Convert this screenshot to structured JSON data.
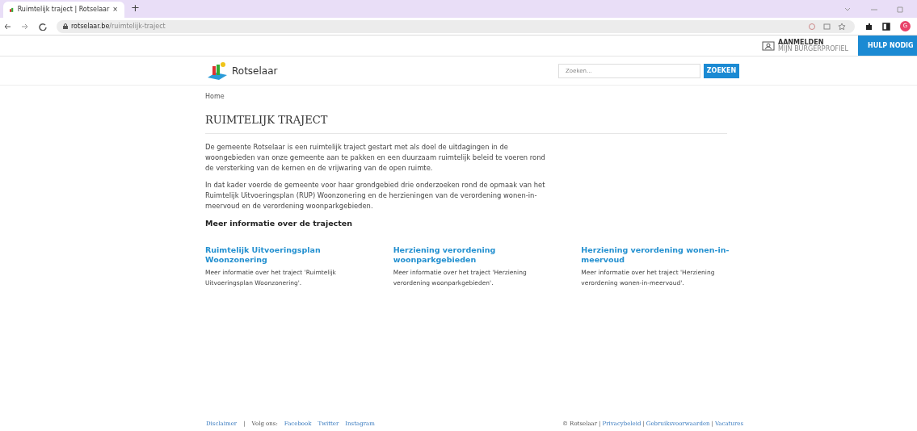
{
  "browser": {
    "tab_title": "Ruimtelijk traject | Rotselaar",
    "close": "×",
    "new_tab": "+",
    "url_host": "rotselaar.be",
    "url_path": "/ruimtelijk-traject",
    "profile_initial": "G"
  },
  "topbar": {
    "login_title": "AANMELDEN",
    "login_subtitle": "MIJN BURGERPROFIEL",
    "help": "HULP NODIG"
  },
  "header": {
    "logo_text": "Rotselaar",
    "search_placeholder": "Zoeken...",
    "search_button": "ZOEKEN"
  },
  "breadcrumb": "Home",
  "title": "RUIMTELIJK TRAJECT",
  "paragraphs": [
    "De gemeente Rotselaar is een ruimtelijk traject gestart met als doel de uitdagingen in de woongebieden van onze gemeente aan te pakken en een duurzaam ruimtelijk beleid te voeren rond de versterking van de kernen en de vrijwaring van de open ruimte.",
    "In dat kader voerde de gemeente voor haar grondgebied drie onderzoeken rond de opmaak van het Ruimtelijk Uitvoeringsplan (RUP) Woonzonering en de herzieningen van de verordening wonen-in-meervoud en de verordening woonparkgebieden."
  ],
  "subheading": "Meer informatie over de trajecten",
  "cards": [
    {
      "title": "Ruimtelijk Uitvoeringsplan Woonzonering",
      "text": "Meer informatie over het traject 'Ruimtelijk Uitvoeringsplan Woonzonering'."
    },
    {
      "title": "Herziening verordening woonparkgebieden",
      "text": "Meer informatie over het traject 'Herziening verordening woonparkgebieden'."
    },
    {
      "title": "Herziening verordening wonen-in-meervoud",
      "text": "Meer informatie over het traject 'Herziening verordening wonen-in-meervoud'."
    }
  ],
  "footer": {
    "left": [
      {
        "kind": "link",
        "text": "Disclaimer"
      },
      {
        "kind": "separator",
        "text": "|"
      },
      {
        "kind": "label",
        "text": "Volg ons:"
      },
      {
        "kind": "link",
        "text": "Facebook"
      },
      {
        "kind": "link",
        "text": "Twitter"
      },
      {
        "kind": "link",
        "text": "Instagram"
      }
    ],
    "right": [
      {
        "kind": "label",
        "text": "© Rotselaar"
      },
      {
        "kind": "separator",
        "text": "|"
      },
      {
        "kind": "link",
        "text": "Privacybeleid"
      },
      {
        "kind": "separator",
        "text": "|"
      },
      {
        "kind": "link",
        "text": "Gebruiksvoorwaarden"
      },
      {
        "kind": "separator",
        "text": "|"
      },
      {
        "kind": "link",
        "text": "Vacatures"
      }
    ]
  }
}
